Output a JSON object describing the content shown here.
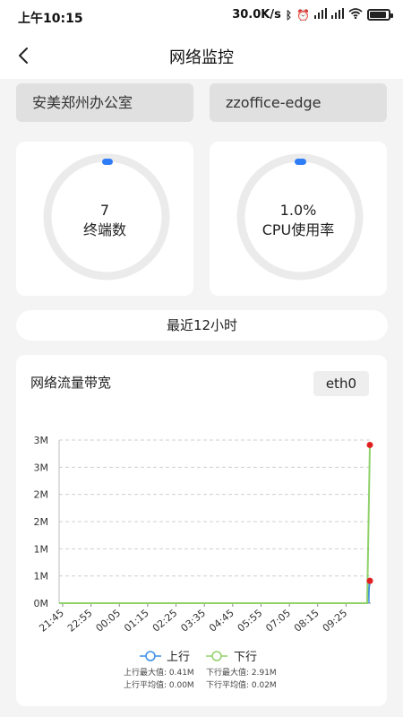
{
  "status_bar": {
    "time": "上午10:15",
    "net_speed": "30.0K/s",
    "icons": [
      "bluetooth-icon",
      "alarm-icon",
      "signal-icon",
      "signal-icon",
      "wifi-icon",
      "battery-icon"
    ],
    "battery_level": 0.9
  },
  "nav": {
    "title": "网络监控"
  },
  "selectors": {
    "location": "安美郑州办公室",
    "device": "zzoffice-edge"
  },
  "gauges": [
    {
      "value": "7",
      "label": "终端数",
      "fraction": 0.0
    },
    {
      "value": "1.0%",
      "label": "CPU使用率",
      "fraction": 0.01
    }
  ],
  "time_range": "最近12小时",
  "bandwidth": {
    "title": "网络流量带宽",
    "interface": "eth0",
    "legend": {
      "up": "上行",
      "down": "下行"
    },
    "stats": {
      "up_max": "上行最大值: 0.41M",
      "down_max": "下行最大值: 2.91M",
      "up_avg": "上行平均值: 0.00M",
      "down_avg": "下行平均值: 0.02M"
    }
  },
  "colors": {
    "accent": "#2f7df6",
    "up_series": "#3a8ee6",
    "down_series": "#8fd16b",
    "peak_marker": "#e02020"
  },
  "chart_data": {
    "type": "line",
    "x_tick_labels": [
      "21:45",
      "22:55",
      "00:05",
      "01:15",
      "02:25",
      "03:35",
      "04:45",
      "05:55",
      "07:05",
      "08:15",
      "09:25"
    ],
    "y_tick_labels": [
      "0M",
      "1M",
      "1M",
      "2M",
      "2M",
      "3M",
      "3M"
    ],
    "ylim": [
      0,
      3
    ],
    "grid": true,
    "legend_position": "bottom",
    "series": [
      {
        "name": "上行",
        "values": [
          0,
          0,
          0,
          0,
          0,
          0,
          0,
          0,
          0,
          0,
          0,
          0.41
        ]
      },
      {
        "name": "下行",
        "values": [
          0,
          0,
          0,
          0,
          0,
          0,
          0,
          0,
          0,
          0,
          0,
          2.91
        ]
      }
    ]
  }
}
